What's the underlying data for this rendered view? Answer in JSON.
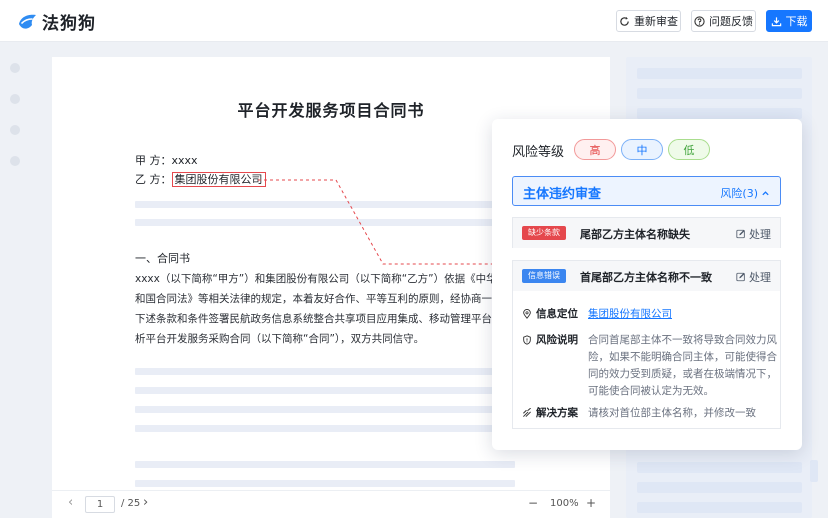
{
  "app": {
    "name": "法狗狗"
  },
  "toolbar": {
    "recheck_label": "重新审查",
    "feedback_label": "问题反馈",
    "download_label": "下载"
  },
  "document": {
    "title": "平台开发服务项目合同书",
    "party_a_label": "甲 方：",
    "party_a_value": "xxxx",
    "party_b_label": "乙 方：",
    "party_b_value": "集团股份有限公司",
    "section_title": "一、合同书",
    "paragraph_lines": [
      "xxxx（以下简称“甲方”）和集团股份有限公司（以下简称“乙方”）依据《中华人民共",
      "和国合同法》等相关法律的规定，本着友好合作、平等互利的原则，经协商一致，现就",
      "下述条款和条件签署民航政务信息系统整合共享项目应用集成、移动管理平台及数据分",
      "析平台开发服务采购合同（以下简称“合同”），双方共同信守。"
    ]
  },
  "pager": {
    "current_page": "1",
    "total_pages": "/ 25",
    "zoom": "100%",
    "zoom_out": "−",
    "zoom_in": "+",
    "prev": "‹",
    "next": "›"
  },
  "risk_panel": {
    "level_label": "风险等级",
    "levels": [
      "高",
      "中",
      "低"
    ],
    "category": {
      "title": "主体违约审查",
      "count_label": "风险(3)"
    },
    "items": [
      {
        "tag": "缺少条款",
        "title": "尾部乙方主体名称缺失",
        "action": "处理"
      },
      {
        "tag": "信息错误",
        "title": "首尾部乙方主体名称不一致",
        "action": "处理",
        "details": {
          "location_label": "信息定位",
          "location_value": "集团股份有限公司",
          "explanation_label": "风险说明",
          "explanation_value": "合同首尾部主体不一致将导致合同效力风险，如果不能明确合同主体，可能使得合同的效力受到质疑，或者在极端情况下，可能使合同被认定为无效。",
          "solution_label": "解决方案",
          "solution_value": "请核对首位部主体名称，并修改一致"
        }
      }
    ]
  },
  "colors": {
    "primary": "#1677ff",
    "danger": "#e5484d",
    "success": "#3fa33a"
  }
}
